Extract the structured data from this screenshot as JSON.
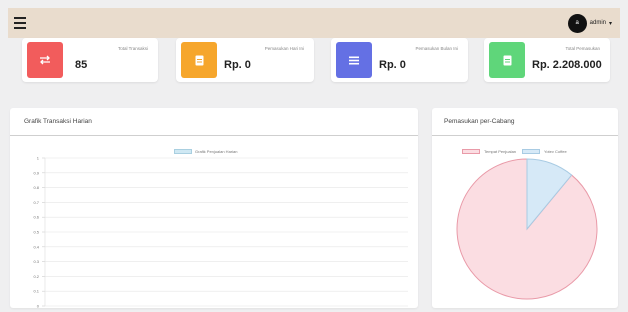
{
  "topbar": {
    "username": "admin",
    "avatar_initial": "a",
    "caret": "▾"
  },
  "cards": [
    {
      "label": "Total Transaksi",
      "value": "85",
      "icon": "transfer-arrows-icon",
      "color": "#f25c5c"
    },
    {
      "label": "Pemasukan Hari Ini",
      "value": "Rp. 0",
      "icon": "document-icon",
      "color": "#f6a62c"
    },
    {
      "label": "Pemasukan Bulan Ini",
      "value": "Rp. 0",
      "icon": "list-icon",
      "color": "#6470e4"
    },
    {
      "label": "Total Pemasukan",
      "value": "Rp. 2.208.000",
      "icon": "document-icon",
      "color": "#5fd67a"
    }
  ],
  "line_panel": {
    "title": "Grafik Transaksi Harian"
  },
  "pie_panel": {
    "title": "Pemasukan per-Cabang"
  },
  "chart_data": [
    {
      "type": "line",
      "title": "",
      "series": [
        {
          "name": "Grafik Penjualan Harian",
          "values": []
        }
      ],
      "y_ticks": [
        "1",
        "0.9",
        "0.8",
        "0.7",
        "0.6",
        "0.5",
        "0.4",
        "0.3",
        "0.2",
        "0.1",
        "0"
      ],
      "ylim": [
        0,
        1
      ],
      "grid": true,
      "legend": "top-center",
      "colors": {
        "fill": "#cfe8f3",
        "stroke": "#a9cfe0"
      }
    },
    {
      "type": "pie",
      "title": "",
      "categories": [
        "Tempat Penjualan",
        "Yotev Coffee"
      ],
      "values": [
        89,
        11
      ],
      "colors": [
        "#fbdde2",
        "#d6e9f7"
      ],
      "stroke_colors": [
        "#e99aa8",
        "#a8cbe3"
      ],
      "legend": "top-center"
    }
  ]
}
